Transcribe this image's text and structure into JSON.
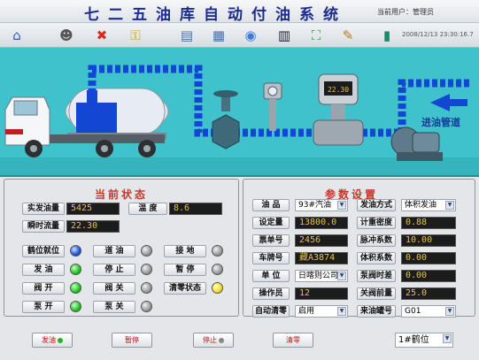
{
  "header": {
    "title": "七二五油库自动付油系统",
    "user": "当前用户：管理员"
  },
  "toolbar": {
    "datetime": "2008/12/13 23:30:16.7",
    "icons": [
      "home-icon",
      "users-icon",
      "close-icon",
      "key-icon",
      "monitor-icon",
      "terminal-icon",
      "disc-icon",
      "chart-icon",
      "network-icon",
      "edit-icon",
      "exit-icon"
    ]
  },
  "scene": {
    "inlet_label": "进油管道",
    "meter_reading": "22.30"
  },
  "status": {
    "title": "当前状态",
    "actual_label": "实发油量",
    "actual_value": "5425",
    "temp_label": "温  度",
    "temp_value": "8.6",
    "flow_label": "瞬时流量",
    "flow_value": "22.30",
    "indicators": [
      {
        "label": "鹤位就位",
        "color": "blue"
      },
      {
        "label": "道  油",
        "color": "gray"
      },
      {
        "label": "接  地",
        "color": "gray"
      },
      {
        "label": "发  油",
        "color": "green"
      },
      {
        "label": "停  止",
        "color": "gray"
      },
      {
        "label": "暂  停",
        "color": "gray"
      },
      {
        "label": "阀  开",
        "color": "green"
      },
      {
        "label": "阀  关",
        "color": "gray"
      },
      {
        "label": "清零状态",
        "color": "yellow"
      },
      {
        "label": "泵  开",
        "color": "green"
      },
      {
        "label": "泵  关",
        "color": "gray"
      }
    ]
  },
  "params": {
    "title": "参数设置",
    "product_label": "油  品",
    "product_value": "93#汽油",
    "method_label": "发油方式",
    "method_value": "体积发油",
    "setpoint_label": "设定量",
    "setpoint_value": "13800.0",
    "density_label": "计重密度",
    "density_value": "0.88",
    "ticket_label": "票单号",
    "ticket_value": "2456",
    "pulse_label": "脉冲系数",
    "pulse_value": "10.00",
    "plate_label": "车牌号",
    "plate_value": "藏A3874",
    "volcoef_label": "体积系数",
    "volcoef_value": "0.00",
    "unit_label": "单  位",
    "unit_value": "日喀则公司",
    "delay_label": "泵阀时差",
    "delay_value": "0.00",
    "operator_label": "操作员",
    "operator_value": "12",
    "prevalve_label": "关阀前量",
    "prevalve_value": "25.0",
    "autozero_label": "自动清零",
    "autozero_value": "启用",
    "tank_label": "来油罐号",
    "tank_value": "G01"
  },
  "actions": {
    "start": "发油",
    "pause": "暂停",
    "stop": "停止",
    "clear": "清零",
    "position": "1#鹤位"
  },
  "colors": {
    "scene_bg": "#3fc2cc",
    "pipe_blue": "#1446d4",
    "title_blue": "#1d2c8a",
    "section_red": "#c0392b",
    "lcd_text": "#e7c34a"
  }
}
